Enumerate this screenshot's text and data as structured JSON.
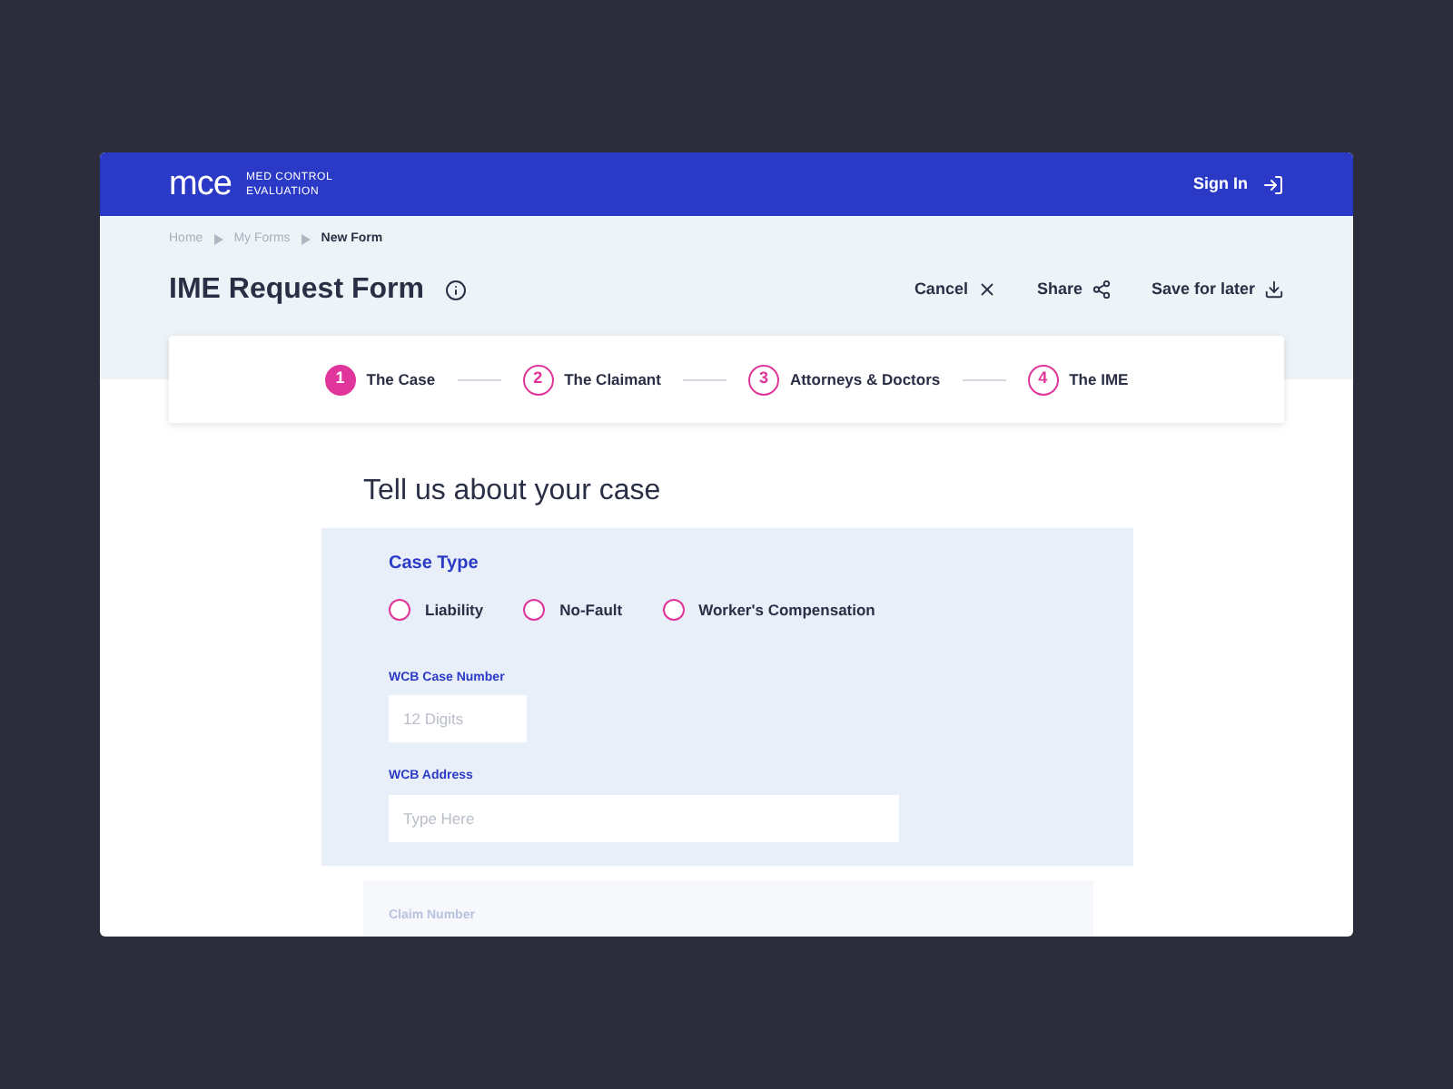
{
  "header": {
    "logo": "mce",
    "brand_line_1": "MED CONTROL",
    "brand_line_2": "EVALUATION",
    "sign_in": "Sign In"
  },
  "breadcrumbs": [
    {
      "label": "Home",
      "current": false
    },
    {
      "label": "My Forms",
      "current": false
    },
    {
      "label": "New Form",
      "current": true
    }
  ],
  "title": "IME Request Form",
  "actions": [
    {
      "label": "Cancel",
      "kind": "close"
    },
    {
      "label": "Share",
      "kind": "share"
    },
    {
      "label": "Save for later",
      "kind": "download"
    }
  ],
  "steps": [
    {
      "number": "1",
      "label": "The Case",
      "selected": true
    },
    {
      "number": "2",
      "label": "The Claimant",
      "selected": false
    },
    {
      "number": "3",
      "label": "Attorneys & Doctors",
      "selected": false
    },
    {
      "number": "4",
      "label": "The IME",
      "selected": false
    }
  ],
  "section_title": "Tell us about your case",
  "case_type": {
    "label": "Case Type",
    "options": [
      {
        "label": "Liability",
        "selected": false
      },
      {
        "label": "No-Fault",
        "selected": false
      },
      {
        "label": "Worker's Compensation",
        "selected": false
      }
    ]
  },
  "fields": [
    {
      "label": "WCB Case Number",
      "placeholder": "12 Digits",
      "kind": "short"
    },
    {
      "label": "WCB Address",
      "placeholder": "Type Here",
      "kind": "long"
    }
  ],
  "next_field": {
    "label": "Claim Number"
  }
}
